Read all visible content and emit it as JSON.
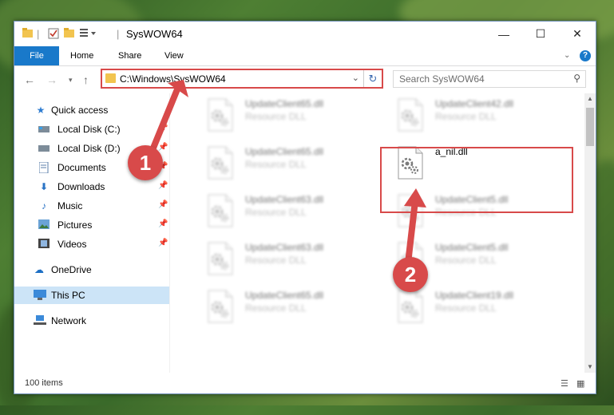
{
  "window": {
    "title": "SysWOW64",
    "minimize_glyph": "—",
    "maximize_glyph": "☐",
    "close_glyph": "✕"
  },
  "ribbon": {
    "tabs": [
      "File",
      "Home",
      "Share",
      "View"
    ],
    "help_glyph": "?"
  },
  "navbar": {
    "address": "C:\\Windows\\SysWOW64",
    "search_placeholder": "Search SysWOW64"
  },
  "sidebar": {
    "items": [
      {
        "label": "Quick access",
        "icon": "star-icon",
        "pinned": false
      },
      {
        "label": "Local Disk (C:)",
        "icon": "drive-icon",
        "pinned": true
      },
      {
        "label": "Local Disk (D:)",
        "icon": "drive-icon",
        "pinned": true
      },
      {
        "label": "Documents",
        "icon": "documents-icon",
        "pinned": true
      },
      {
        "label": "Downloads",
        "icon": "download-icon",
        "pinned": true
      },
      {
        "label": "Music",
        "icon": "music-icon",
        "pinned": true
      },
      {
        "label": "Pictures",
        "icon": "pictures-icon",
        "pinned": true
      },
      {
        "label": "Videos",
        "icon": "videos-icon",
        "pinned": true
      },
      {
        "label": "OneDrive",
        "icon": "cloud-icon",
        "pinned": false
      },
      {
        "label": "This PC",
        "icon": "computer-icon",
        "pinned": false,
        "selected": true
      },
      {
        "label": "Network",
        "icon": "network-icon",
        "pinned": false
      }
    ]
  },
  "files": {
    "left": [
      {
        "name": "UpdateClient65.dll",
        "type": "Resource DLL"
      },
      {
        "name": "UpdateClient65.dll",
        "type": "Resource DLL"
      },
      {
        "name": "UpdateClient63.dll",
        "type": "Resource DLL"
      },
      {
        "name": "UpdateClient63.dll",
        "type": "Resource DLL"
      },
      {
        "name": "UpdateClient65.dll",
        "type": "Resource DLL"
      }
    ],
    "right": [
      {
        "name": "UpdateClient42.dll",
        "type": "Resource DLL"
      },
      {
        "name": "a_nil.dll",
        "type": ""
      },
      {
        "name": "UpdateClient5.dll",
        "type": "Resource DLL"
      },
      {
        "name": "UpdateClient5.dll",
        "type": "Resource DLL"
      },
      {
        "name": "UpdateClient19.dll",
        "type": "Resource DLL"
      }
    ]
  },
  "status": {
    "item_count": "100 items"
  },
  "annotations": {
    "step1": "1",
    "step2": "2",
    "color": "#d84a4a"
  }
}
